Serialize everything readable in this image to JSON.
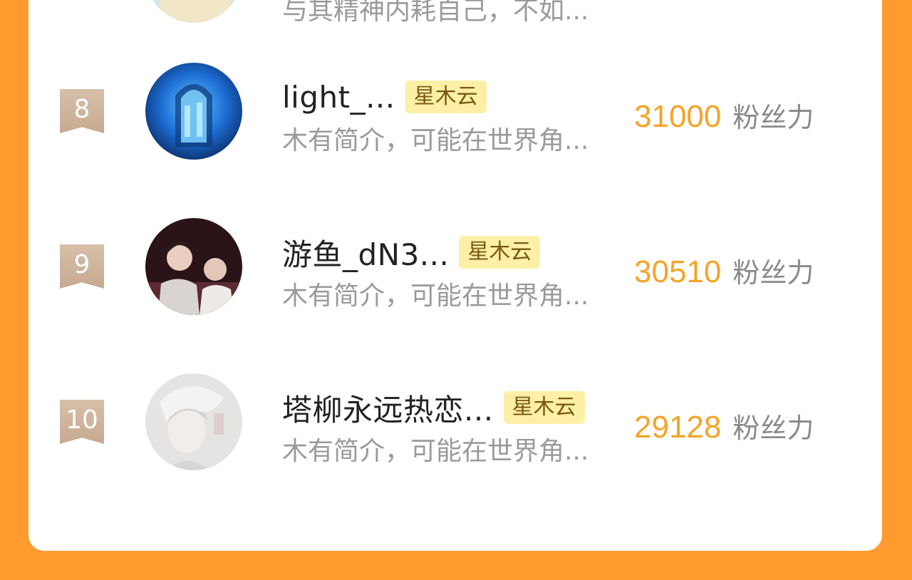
{
  "partial_row": {
    "desc": "与其精神内耗自己，不如..."
  },
  "rows": [
    {
      "rank": "8",
      "name": "light_...",
      "tag": "星木云",
      "desc": "木有简介，可能在世界角...",
      "fans": "31000",
      "fans_unit": "粉丝力",
      "avatar": "blue-window-avatar"
    },
    {
      "rank": "9",
      "name": "游鱼_dN3...",
      "tag": "星木云",
      "desc": "木有简介，可能在世界角...",
      "fans": "30510",
      "fans_unit": "粉丝力",
      "avatar": "two-men-avatar"
    },
    {
      "rank": "10",
      "name": "塔柳永远热恋...",
      "tag": "星木云",
      "desc": "木有简介，可能在世界角...",
      "fans": "29128",
      "fans_unit": "粉丝力",
      "avatar": "white-hair-avatar"
    }
  ],
  "colors": {
    "background": "#FE9A2E",
    "card": "#FFFFFF",
    "fans_number": "#F5A327",
    "tag_bg": "#FDF0A6",
    "rank_badge": "#CBAF95"
  }
}
